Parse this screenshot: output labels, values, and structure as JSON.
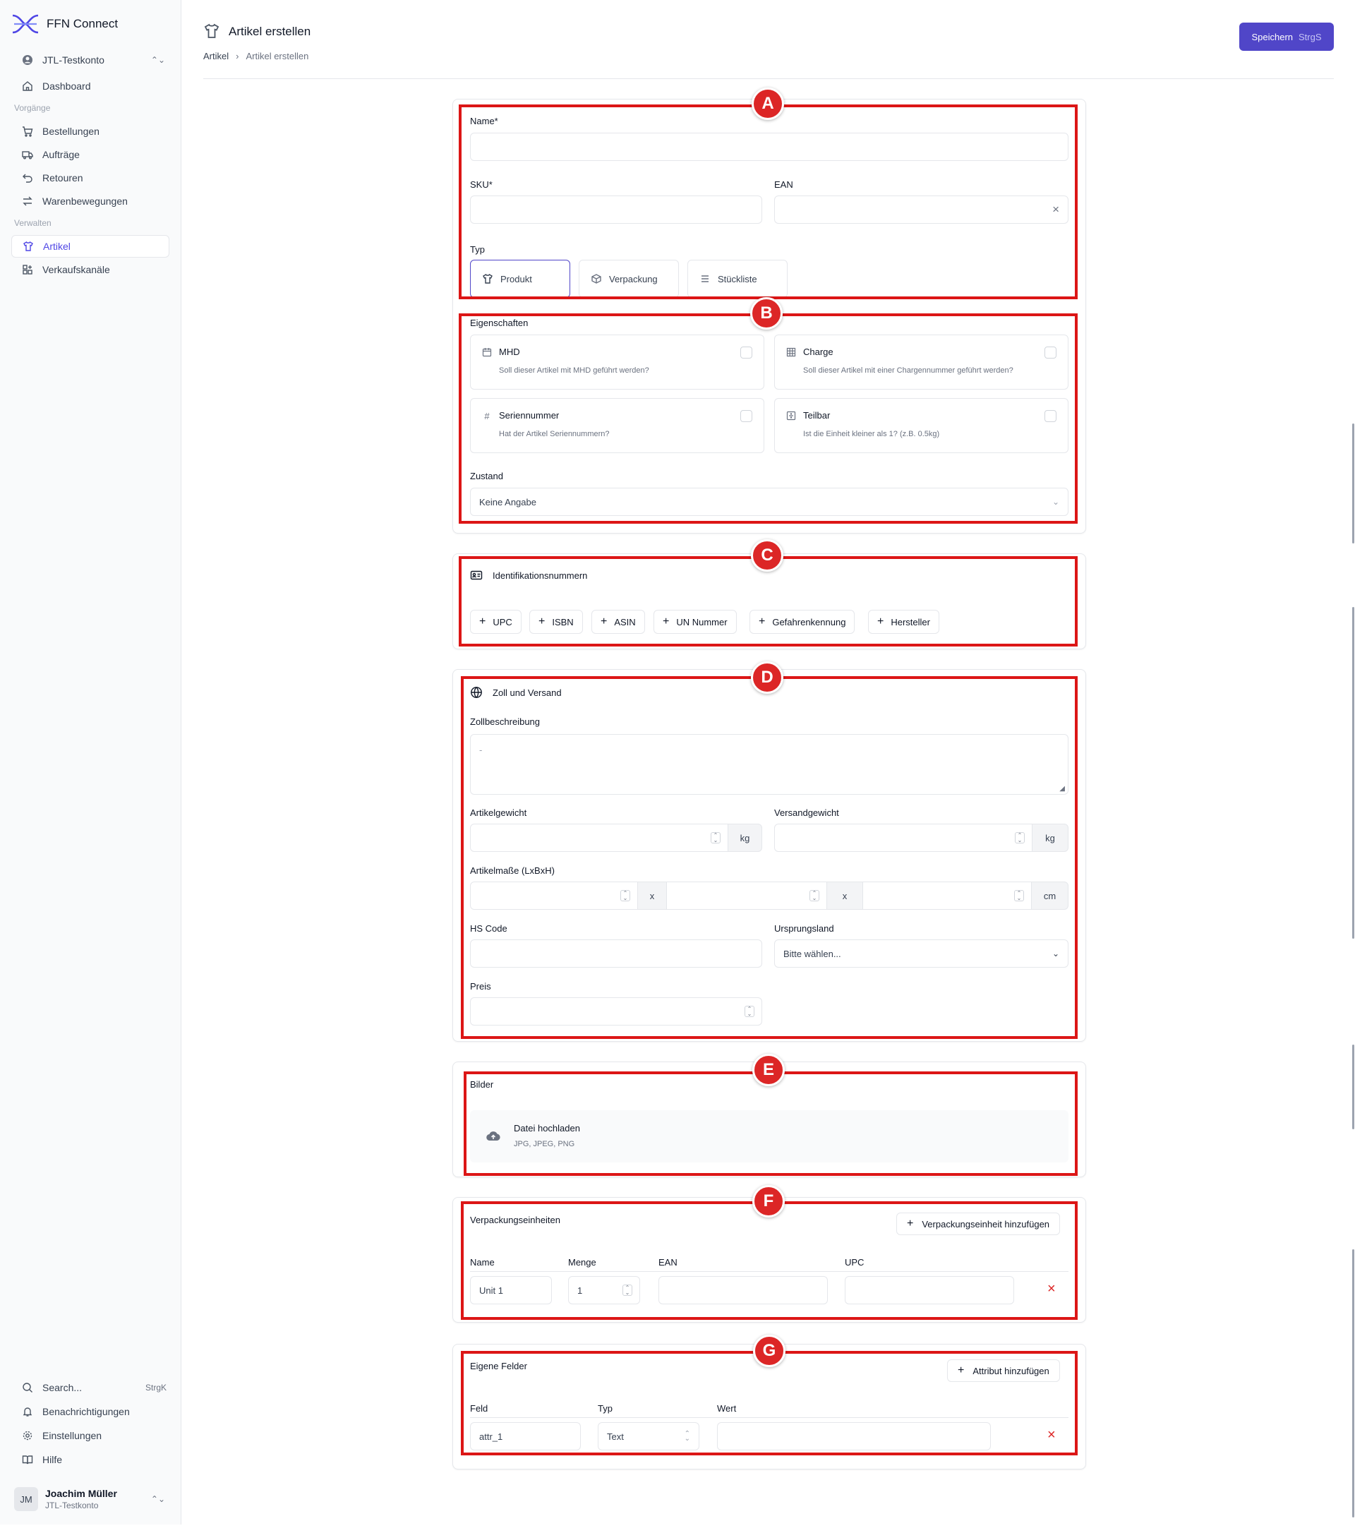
{
  "app": {
    "name": "FFN Connect"
  },
  "sidebar": {
    "account": "JTL-Testkonto",
    "dashboard": "Dashboard",
    "section_processes": "Vorgänge",
    "orders": "Bestellungen",
    "jobs": "Aufträge",
    "returns": "Retouren",
    "movements": "Warenbewegungen",
    "section_manage": "Verwalten",
    "articles": "Artikel",
    "channels": "Verkaufskanäle",
    "search": "Search...",
    "search_kbd": "StrgK",
    "notifications": "Benachrichtigungen",
    "settings": "Einstellungen",
    "help": "Hilfe",
    "user_initials": "JM",
    "user_name": "Joachim Müller",
    "user_account": "JTL-Testkonto"
  },
  "header": {
    "title": "Artikel erstellen",
    "breadcrumb_1": "Artikel",
    "breadcrumb_2": "Artikel erstellen",
    "save_label": "Speichern",
    "save_kbd": "StrgS"
  },
  "markers": {
    "a": "A",
    "b": "B",
    "c": "C",
    "d": "D",
    "e": "E",
    "f": "F",
    "g": "G"
  },
  "general": {
    "name_label": "Name*",
    "sku_label": "SKU*",
    "ean_label": "EAN",
    "type_label": "Typ",
    "type_product": "Produkt",
    "type_packaging": "Verpackung",
    "type_bom": "Stückliste"
  },
  "properties": {
    "label": "Eigenschaften",
    "mhd_title": "MHD",
    "mhd_desc": "Soll dieser Artikel mit MHD geführt werden?",
    "charge_title": "Charge",
    "charge_desc": "Soll dieser Artikel mit einer Chargennummer geführt werden?",
    "serial_title": "Seriennummer",
    "serial_desc": "Hat der Artikel Seriennummern?",
    "divisible_title": "Teilbar",
    "divisible_desc": "Ist die Einheit kleiner als 1? (z.B. 0.5kg)",
    "condition_label": "Zustand",
    "condition_value": "Keine Angabe"
  },
  "identifiers": {
    "title": "Identifikationsnummern",
    "upc": "UPC",
    "isbn": "ISBN",
    "asin": "ASIN",
    "un": "UN Nummer",
    "hazard": "Gefahrenkennung",
    "manufacturer": "Hersteller"
  },
  "customs": {
    "title": "Zoll und Versand",
    "desc_label": "Zollbeschreibung",
    "desc_placeholder": "-",
    "weight_label": "Artikelgewicht",
    "ship_weight_label": "Versandgewicht",
    "unit_kg": "kg",
    "dims_label": "Artikelmaße (LxBxH)",
    "dims_sep": "x",
    "unit_cm": "cm",
    "hs_label": "HS Code",
    "origin_label": "Ursprungsland",
    "origin_value": "Bitte wählen...",
    "price_label": "Preis"
  },
  "images": {
    "label": "Bilder",
    "upload": "Datei hochladen",
    "formats": "JPG, JPEG, PNG"
  },
  "packaging": {
    "label": "Verpackungseinheiten",
    "add": "Verpackungseinheit hinzufügen",
    "col_name": "Name",
    "col_qty": "Menge",
    "col_ean": "EAN",
    "col_upc": "UPC",
    "row_name": "Unit 1",
    "row_qty": "1"
  },
  "custom_fields": {
    "label": "Eigene Felder",
    "add": "Attribut hinzufügen",
    "col_field": "Feld",
    "col_type": "Typ",
    "col_value": "Wert",
    "row_field": "attr_1",
    "row_type": "Text"
  }
}
